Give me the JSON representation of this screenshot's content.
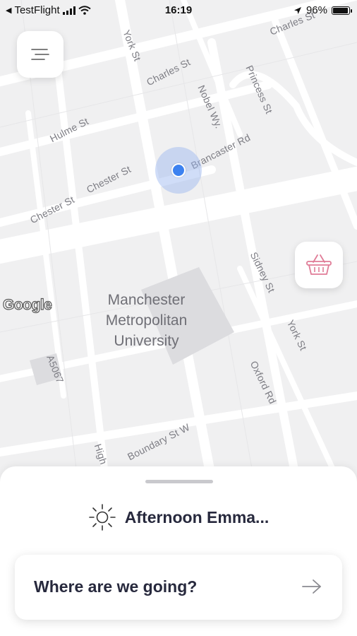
{
  "status_bar": {
    "back_app": "TestFlight",
    "time": "16:19",
    "battery_percent": "96%",
    "battery_level": 0.96
  },
  "map": {
    "streets": [
      {
        "name": "York St"
      },
      {
        "name": "Charles St"
      },
      {
        "name": "Charles St"
      },
      {
        "name": "Princess St"
      },
      {
        "name": "Nobel Wy."
      },
      {
        "name": "Hulme St"
      },
      {
        "name": "Brancaster Rd"
      },
      {
        "name": "Chester St"
      },
      {
        "name": "Chester St"
      },
      {
        "name": "Sidney St"
      },
      {
        "name": "York St"
      },
      {
        "name": "A5067"
      },
      {
        "name": "Oxford Rd"
      },
      {
        "name": "Boundary St W"
      },
      {
        "name": "High"
      }
    ],
    "poi_lines": [
      "Manchester",
      "Metropolitan",
      "University"
    ],
    "attribution": "Google"
  },
  "sheet": {
    "greeting": "Afternoon Emma...",
    "search_label": "Where are we going?"
  },
  "icons": {
    "menu": "menu-icon",
    "basket": "basket-icon",
    "sun": "sun-icon",
    "arrow": "arrow-right-icon",
    "location_arrow": "location-arrow-icon"
  },
  "colors": {
    "location": "#3d82f0",
    "basket": "#e07c97",
    "text_dark": "#27293d"
  }
}
